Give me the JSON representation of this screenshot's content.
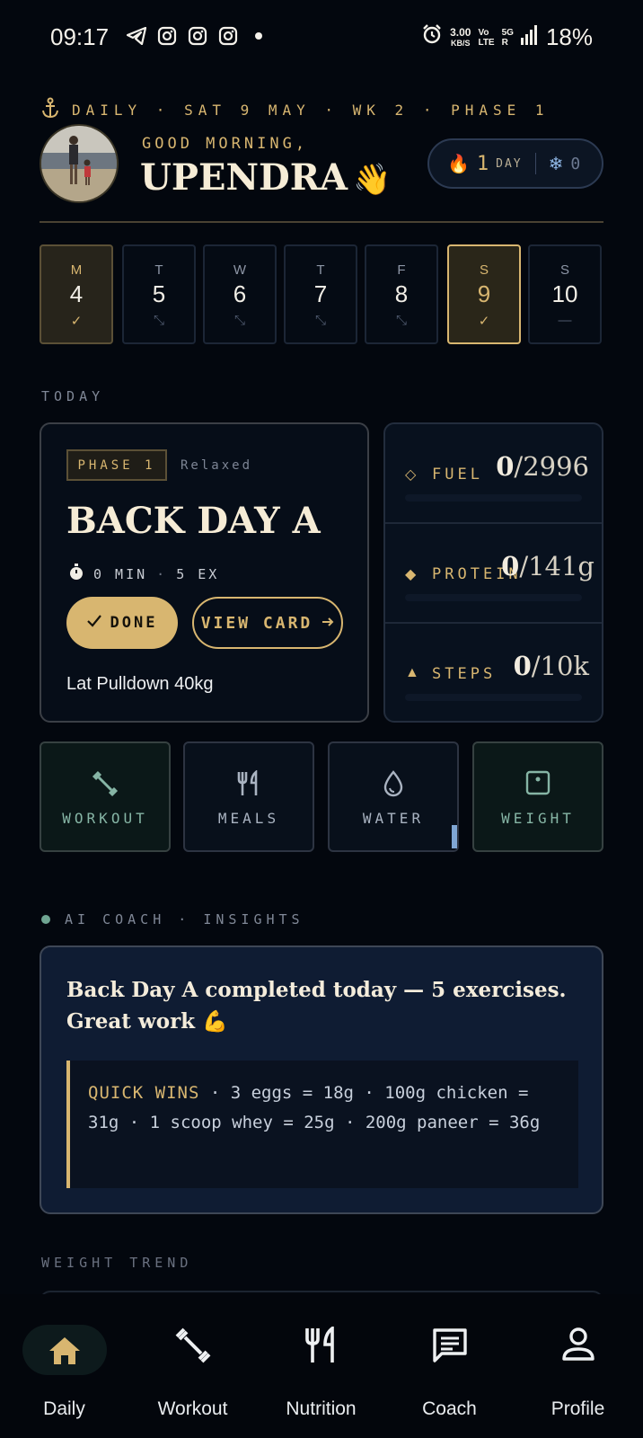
{
  "status_bar": {
    "time": "09:17",
    "speed_value": "3.00",
    "speed_unit": "KB/S",
    "net_top": "Vo",
    "net_bottom": "LTE",
    "net5g_top": "5G",
    "net5g_bottom": "R",
    "battery": "18%",
    "icons": [
      "telegram-icon",
      "instagram-icon",
      "instagram-icon",
      "instagram-icon",
      "dot-icon",
      "alarm-icon",
      "signal-icon"
    ]
  },
  "header": {
    "daily_line": "DAILY · SAT 9 MAY · WK 2 · PHASE 1",
    "greeting": "GOOD MORNING,",
    "name": "UPENDRA",
    "wave": "👋",
    "streak": {
      "count": "1",
      "unit": "DAY",
      "freeze": "0"
    }
  },
  "week": [
    {
      "letter": "M",
      "num": "4",
      "mark": "✓",
      "state": "done"
    },
    {
      "letter": "T",
      "num": "5",
      "mark": "⤡",
      "state": "rest"
    },
    {
      "letter": "W",
      "num": "6",
      "mark": "⤡",
      "state": "rest"
    },
    {
      "letter": "T",
      "num": "7",
      "mark": "⤡",
      "state": "rest"
    },
    {
      "letter": "F",
      "num": "8",
      "mark": "⤡",
      "state": "rest"
    },
    {
      "letter": "S",
      "num": "9",
      "mark": "✓",
      "state": "today"
    },
    {
      "letter": "S",
      "num": "10",
      "mark": "—",
      "state": "future"
    }
  ],
  "today": {
    "label": "TODAY",
    "phase": "PHASE 1",
    "mode": "Relaxed",
    "title": "BACK DAY A",
    "duration": "0 MIN",
    "sep": "·",
    "exercises": "5 EX",
    "done_label": "DONE",
    "view_label": "VIEW CARD",
    "note": "Lat Pulldown 40kg"
  },
  "stats": [
    {
      "symbol": "◇",
      "label": "FUEL",
      "value": "0",
      "target": "/2996",
      "progress": 0
    },
    {
      "symbol": "◆",
      "label": "PROTEIN",
      "value": "0",
      "target": "/141g",
      "progress": 0
    },
    {
      "symbol": "▲",
      "label": "STEPS",
      "value": "0",
      "target": "/10k",
      "progress": 0
    }
  ],
  "quick_actions": [
    {
      "label": "WORKOUT",
      "icon": "dumbbell-icon"
    },
    {
      "label": "MEALS",
      "icon": "fork-knife-icon"
    },
    {
      "label": "WATER",
      "icon": "water-drop-icon"
    },
    {
      "label": "WEIGHT",
      "icon": "scale-icon"
    }
  ],
  "coach": {
    "label": "AI COACH · INSIGHTS",
    "headline": "Back Day A completed today — 5 exercises. Great work 💪",
    "quick_wins_title": "QUICK WINS",
    "quick_wins_text": " · 3 eggs = 18g · 100g chicken = 31g · 1 scoop whey = 25g · 200g paneer = 36g"
  },
  "weight_trend": {
    "label": "WEIGHT TREND"
  },
  "nav": [
    {
      "label": "Daily",
      "icon": "home-icon",
      "active": true
    },
    {
      "label": "Workout",
      "icon": "dumbbell-icon"
    },
    {
      "label": "Nutrition",
      "icon": "fork-knife-icon"
    },
    {
      "label": "Coach",
      "icon": "chat-icon"
    },
    {
      "label": "Profile",
      "icon": "person-icon"
    }
  ],
  "colors": {
    "accent": "#d8b670",
    "background": "#03070e",
    "green": "#86b5a5",
    "water": "#7fa6d4"
  }
}
